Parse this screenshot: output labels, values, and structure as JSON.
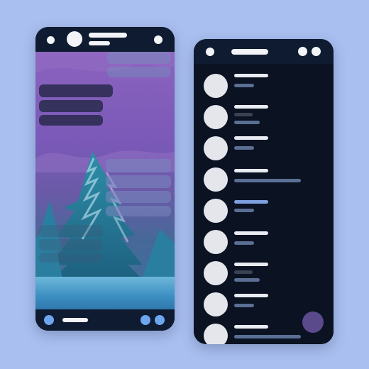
{
  "layout": "two-phone-mockup",
  "left_phone": {
    "type": "chat-screen",
    "background": "snowy-pine-tree-night-photo",
    "top_bar_icons": [
      "dot-icon",
      "avatar-icon",
      "dot-icon"
    ],
    "bottom_bar_icons": [
      "attach-icon",
      "emoji-icon",
      "send-icon"
    ],
    "colors": {
      "bar": "#0f1b30",
      "accent": "#6da6ef"
    }
  },
  "right_phone": {
    "type": "contacts-list",
    "row_count": 9,
    "colors": {
      "bar": "#0f1b30",
      "avatar": "#e4e6ec",
      "fab": "#5a4a8c"
    }
  }
}
